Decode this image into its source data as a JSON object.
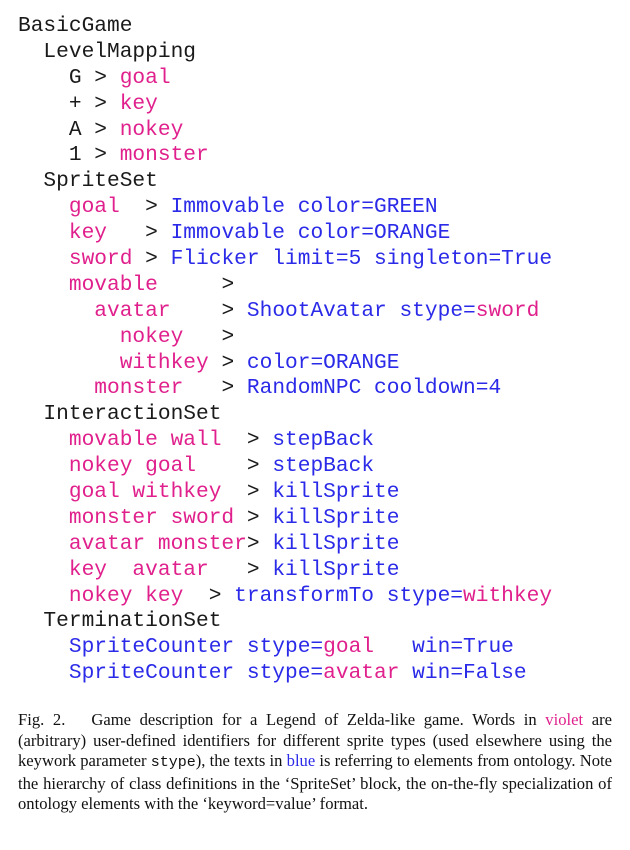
{
  "colors": {
    "user_identifier": "#e0208c",
    "ontology": "#2a2ae8",
    "text": "#1a1a1a"
  },
  "code_lines": [
    [
      {
        "t": "BasicGame",
        "c": "k"
      }
    ],
    [
      {
        "t": "  LevelMapping",
        "c": "k"
      }
    ],
    [
      {
        "t": "    G > ",
        "c": "k"
      },
      {
        "t": "goal",
        "c": "v"
      }
    ],
    [
      {
        "t": "    + > ",
        "c": "k"
      },
      {
        "t": "key",
        "c": "v"
      }
    ],
    [
      {
        "t": "    A > ",
        "c": "k"
      },
      {
        "t": "nokey",
        "c": "v"
      }
    ],
    [
      {
        "t": "    1 > ",
        "c": "k"
      },
      {
        "t": "monster",
        "c": "v"
      }
    ],
    [
      {
        "t": "  SpriteSet",
        "c": "k"
      }
    ],
    [
      {
        "t": "    ",
        "c": "k"
      },
      {
        "t": "goal",
        "c": "v"
      },
      {
        "t": "  > ",
        "c": "k"
      },
      {
        "t": "Immovable color=GREEN",
        "c": "b"
      }
    ],
    [
      {
        "t": "    ",
        "c": "k"
      },
      {
        "t": "key",
        "c": "v"
      },
      {
        "t": "   > ",
        "c": "k"
      },
      {
        "t": "Immovable color=ORANGE",
        "c": "b"
      }
    ],
    [
      {
        "t": "    ",
        "c": "k"
      },
      {
        "t": "sword",
        "c": "v"
      },
      {
        "t": " > ",
        "c": "k"
      },
      {
        "t": "Flicker limit=5 singleton=True",
        "c": "b"
      }
    ],
    [
      {
        "t": "    ",
        "c": "k"
      },
      {
        "t": "movable",
        "c": "v"
      },
      {
        "t": "     >",
        "c": "k"
      }
    ],
    [
      {
        "t": "      ",
        "c": "k"
      },
      {
        "t": "avatar",
        "c": "v"
      },
      {
        "t": "    > ",
        "c": "k"
      },
      {
        "t": "ShootAvatar stype=",
        "c": "b"
      },
      {
        "t": "sword",
        "c": "v"
      }
    ],
    [
      {
        "t": "        ",
        "c": "k"
      },
      {
        "t": "nokey",
        "c": "v"
      },
      {
        "t": "   >",
        "c": "k"
      }
    ],
    [
      {
        "t": "        ",
        "c": "k"
      },
      {
        "t": "withkey",
        "c": "v"
      },
      {
        "t": " > ",
        "c": "k"
      },
      {
        "t": "color=ORANGE",
        "c": "b"
      }
    ],
    [
      {
        "t": "      ",
        "c": "k"
      },
      {
        "t": "monster",
        "c": "v"
      },
      {
        "t": "   > ",
        "c": "k"
      },
      {
        "t": "RandomNPC cooldown=4",
        "c": "b"
      }
    ],
    [
      {
        "t": "  InteractionSet",
        "c": "k"
      }
    ],
    [
      {
        "t": "    ",
        "c": "k"
      },
      {
        "t": "movable wall",
        "c": "v"
      },
      {
        "t": "  > ",
        "c": "k"
      },
      {
        "t": "stepBack",
        "c": "b"
      }
    ],
    [
      {
        "t": "    ",
        "c": "k"
      },
      {
        "t": "nokey goal",
        "c": "v"
      },
      {
        "t": "    > ",
        "c": "k"
      },
      {
        "t": "stepBack",
        "c": "b"
      }
    ],
    [
      {
        "t": "    ",
        "c": "k"
      },
      {
        "t": "goal withkey",
        "c": "v"
      },
      {
        "t": "  > ",
        "c": "k"
      },
      {
        "t": "killSprite",
        "c": "b"
      }
    ],
    [
      {
        "t": "    ",
        "c": "k"
      },
      {
        "t": "monster sword",
        "c": "v"
      },
      {
        "t": " > ",
        "c": "k"
      },
      {
        "t": "killSprite",
        "c": "b"
      }
    ],
    [
      {
        "t": "    ",
        "c": "k"
      },
      {
        "t": "avatar monster",
        "c": "v"
      },
      {
        "t": "> ",
        "c": "k"
      },
      {
        "t": "killSprite",
        "c": "b"
      }
    ],
    [
      {
        "t": "    ",
        "c": "k"
      },
      {
        "t": "key  avatar",
        "c": "v"
      },
      {
        "t": "   > ",
        "c": "k"
      },
      {
        "t": "killSprite",
        "c": "b"
      }
    ],
    [
      {
        "t": "    ",
        "c": "k"
      },
      {
        "t": "nokey key",
        "c": "v"
      },
      {
        "t": "  > ",
        "c": "k"
      },
      {
        "t": "transformTo stype=",
        "c": "b"
      },
      {
        "t": "withkey",
        "c": "v"
      }
    ],
    [
      {
        "t": "  TerminationSet",
        "c": "k"
      }
    ],
    [
      {
        "t": "    ",
        "c": "k"
      },
      {
        "t": "SpriteCounter stype=",
        "c": "b"
      },
      {
        "t": "goal",
        "c": "v"
      },
      {
        "t": "   ",
        "c": "k"
      },
      {
        "t": "win=True",
        "c": "b"
      }
    ],
    [
      {
        "t": "    ",
        "c": "k"
      },
      {
        "t": "SpriteCounter stype=",
        "c": "b"
      },
      {
        "t": "avatar",
        "c": "v"
      },
      {
        "t": " ",
        "c": "k"
      },
      {
        "t": "win=False",
        "c": "b"
      }
    ]
  ],
  "caption": {
    "label": "Fig. 2.",
    "part1": "Game description for a Legend of Zelda-like game. Words in ",
    "violet_word": "violet",
    "part2": " are (arbitrary) user-defined identifiers for different sprite types (used elsewhere using the keywork parameter ",
    "mono_word": "stype",
    "part3": "), the texts in ",
    "blue_word": "blue",
    "part4": " is referring to elements from ontology. Note the hierarchy of class definitions in the ‘SpriteSet’ block, the on-the-fly specialization of ontology elements with the ‘keyword=value’ format."
  }
}
